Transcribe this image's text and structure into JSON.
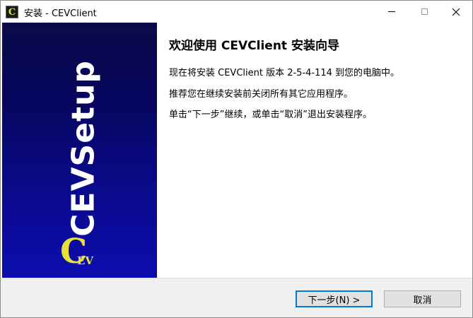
{
  "window": {
    "title": "安装 - CEVClient",
    "app_icon_letter": "C"
  },
  "banner": {
    "vertical_text": "CEVSetup",
    "badge_big": "C",
    "badge_small": "EV",
    "colors": {
      "gradient_top": "#0a0a4a",
      "gradient_bottom": "#0c0cae",
      "logo_yellow": "#e8e236"
    }
  },
  "content": {
    "heading": "欢迎使用 CEVClient 安装向导",
    "line1": "现在将安装 CEVClient 版本 2-5-4-114 到您的电脑中。",
    "line2": "推荐您在继续安装前关闭所有其它应用程序。",
    "line3": "单击“下一步”继续，或单击“取消”退出安装程序。"
  },
  "buttons": {
    "next": "下一步(N) >",
    "cancel": "取消"
  },
  "icons": {
    "minimize": "minimize-icon",
    "maximize": "maximize-icon",
    "close": "close-icon"
  }
}
